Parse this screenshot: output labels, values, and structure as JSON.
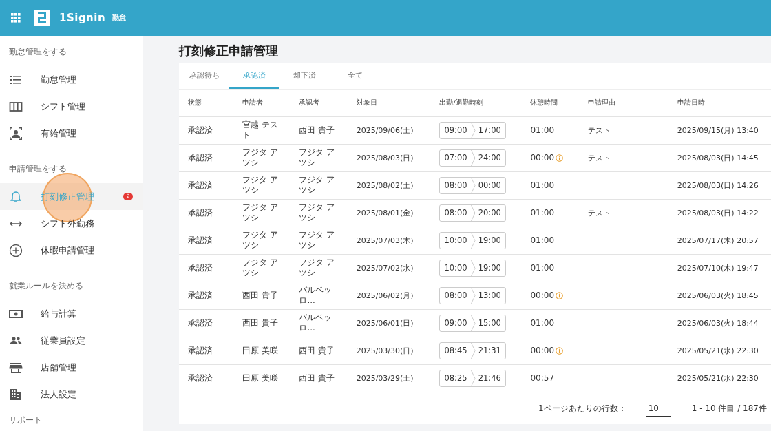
{
  "header": {
    "brand": "1Signin",
    "product": "勤怠"
  },
  "sidebar": {
    "sections": [
      {
        "heading": "勤怠管理をする",
        "items": [
          {
            "kind": "list",
            "label": "勤怠管理",
            "selected": false
          },
          {
            "kind": "columns",
            "label": "シフト管理",
            "selected": false
          },
          {
            "kind": "person",
            "label": "有給管理",
            "selected": false
          }
        ]
      },
      {
        "heading": "申請管理をする",
        "items": [
          {
            "kind": "bell",
            "label": "打刻修正管理",
            "selected": true,
            "badge": "2"
          },
          {
            "kind": "arrows",
            "label": "シフト外勤務",
            "selected": false
          },
          {
            "kind": "plus",
            "label": "休暇申請管理",
            "selected": false
          }
        ]
      },
      {
        "heading": "就業ルールを決める",
        "items": [
          {
            "kind": "money",
            "label": "給与計算",
            "selected": false
          },
          {
            "kind": "people",
            "label": "従業員設定",
            "selected": false
          },
          {
            "kind": "store",
            "label": "店舗管理",
            "selected": false
          },
          {
            "kind": "building",
            "label": "法人設定",
            "selected": false
          }
        ]
      },
      {
        "heading": "サポート"
      }
    ]
  },
  "page_title": "打刻修正申請管理",
  "tabs": [
    {
      "label": "承認待ち",
      "selected": false
    },
    {
      "label": "承認済",
      "selected": true
    },
    {
      "label": "却下済",
      "selected": false
    },
    {
      "label": "全て",
      "selected": false
    }
  ],
  "table": {
    "columns": [
      "状態",
      "申請者",
      "承認者",
      "対象日",
      "出勤/退勤時刻",
      "休憩時間",
      "申請理由",
      "申請日時"
    ],
    "rows": [
      {
        "status": "承認済",
        "applicant": "宮越 テスト",
        "approver": "西田 貴子",
        "date": "2025/09/06(土)",
        "start": "09:00",
        "end": "17:00",
        "break": "01:00",
        "break_warning": false,
        "reason": "テスト",
        "applied_at": "2025/09/15(月) 13:40"
      },
      {
        "status": "承認済",
        "applicant": "フジタ アツシ",
        "approver": "フジタ アツシ",
        "date": "2025/08/03(日)",
        "start": "07:00",
        "end": "24:00",
        "break": "00:00",
        "break_warning": true,
        "reason": "テスト",
        "applied_at": "2025/08/03(日) 14:45"
      },
      {
        "status": "承認済",
        "applicant": "フジタ アツシ",
        "approver": "フジタ アツシ",
        "date": "2025/08/02(土)",
        "start": "08:00",
        "end": "00:00",
        "break": "01:00",
        "break_warning": false,
        "applied_at": "2025/08/03(日) 14:26"
      },
      {
        "status": "承認済",
        "applicant": "フジタ アツシ",
        "approver": "フジタ アツシ",
        "date": "2025/08/01(金)",
        "start": "08:00",
        "end": "20:00",
        "break": "01:00",
        "break_warning": false,
        "reason": "テスト",
        "applied_at": "2025/08/03(日) 14:22"
      },
      {
        "status": "承認済",
        "applicant": "フジタ アツシ",
        "approver": "フジタ アツシ",
        "date": "2025/07/03(木)",
        "start": "10:00",
        "end": "19:00",
        "break": "01:00",
        "break_warning": false,
        "applied_at": "2025/07/17(木) 20:57"
      },
      {
        "status": "承認済",
        "applicant": "フジタ アツシ",
        "approver": "フジタ アツシ",
        "date": "2025/07/02(水)",
        "start": "10:00",
        "end": "19:00",
        "break": "01:00",
        "break_warning": false,
        "applied_at": "2025/07/10(木) 19:47"
      },
      {
        "status": "承認済",
        "applicant": "西田 貴子",
        "approver": "バルベッロ...",
        "date": "2025/06/02(月)",
        "start": "08:00",
        "end": "13:00",
        "break": "00:00",
        "break_warning": true,
        "applied_at": "2025/06/03(火) 18:45"
      },
      {
        "status": "承認済",
        "applicant": "西田 貴子",
        "approver": "バルベッロ...",
        "date": "2025/06/01(日)",
        "start": "09:00",
        "end": "15:00",
        "break": "01:00",
        "break_warning": false,
        "applied_at": "2025/06/03(火) 18:44"
      },
      {
        "status": "承認済",
        "applicant": "田原 美咲",
        "approver": "西田 貴子",
        "date": "2025/03/30(日)",
        "start": "08:45",
        "end": "21:31",
        "break": "00:00",
        "break_warning": true,
        "applied_at": "2025/05/21(水) 22:30"
      },
      {
        "status": "承認済",
        "applicant": "田原 美咲",
        "approver": "西田 貴子",
        "date": "2025/03/29(土)",
        "start": "08:25",
        "end": "21:46",
        "break": "00:57",
        "break_warning": false,
        "applied_at": "2025/05/21(水) 22:30"
      }
    ]
  },
  "pagination": {
    "rows_label": "1ページあたりの行数：",
    "rows_per_page": "10",
    "range": "1 - 10 件目 / 187件"
  }
}
